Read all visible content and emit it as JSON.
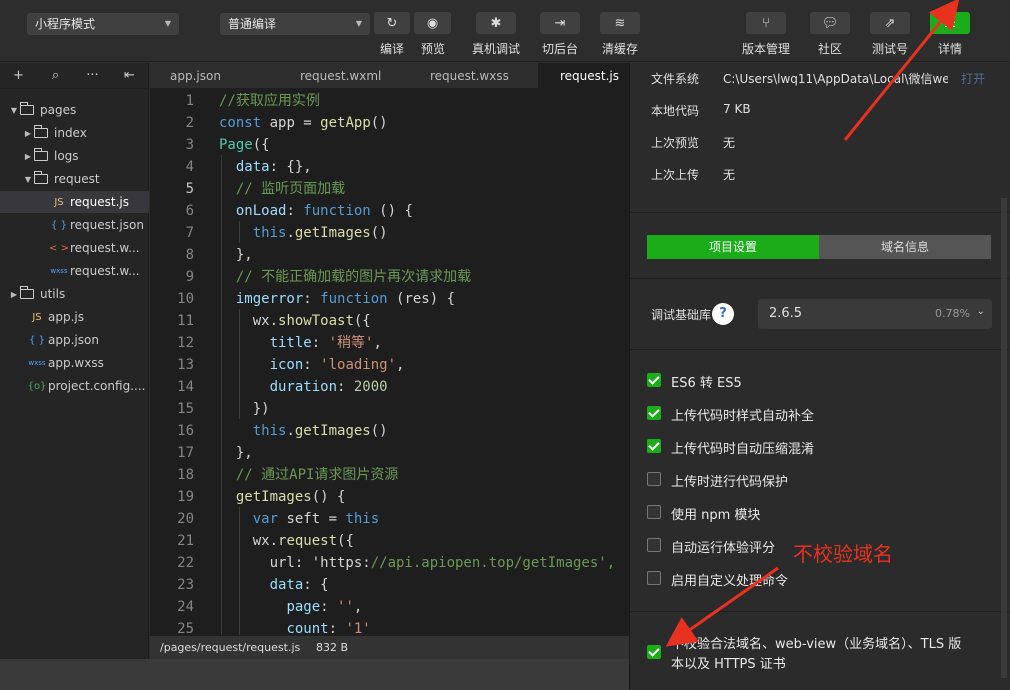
{
  "toolbar": {
    "mode_select": "小程序模式",
    "compile_select": "普通编译",
    "compile_label": "编译",
    "preview_label": "预览",
    "remote_debug_label": "真机调试",
    "background_label": "切后台",
    "clear_cache_label": "清缓存",
    "version_label": "版本管理",
    "community_label": "社区",
    "test_label": "测试号",
    "details_label": "详情"
  },
  "explorer": {
    "items": [
      {
        "label": "pages",
        "type": "folder-open"
      },
      {
        "label": "index",
        "type": "folder"
      },
      {
        "label": "logs",
        "type": "folder"
      },
      {
        "label": "request",
        "type": "folder-open"
      },
      {
        "label": "request.js",
        "type": "js"
      },
      {
        "label": "request.json",
        "type": "json"
      },
      {
        "label": "request.w...",
        "type": "wxml"
      },
      {
        "label": "request.w...",
        "type": "wxss"
      },
      {
        "label": "utils",
        "type": "folder"
      },
      {
        "label": "app.js",
        "type": "js"
      },
      {
        "label": "app.json",
        "type": "json"
      },
      {
        "label": "app.wxss",
        "type": "wxss"
      },
      {
        "label": "project.config....",
        "type": "config"
      }
    ],
    "icon_js": "JS",
    "icon_json": "{ }",
    "icon_wxml": "< >",
    "icon_wxss": "wxss",
    "icon_config": "{o}"
  },
  "tabs": [
    "app.json",
    "request.wxml",
    "request.wxss",
    "request.js"
  ],
  "code_lines": [
    {
      "n": "1",
      "t": "//获取应用实例"
    },
    {
      "n": "2",
      "t": "const app = getApp()"
    },
    {
      "n": "3",
      "t": "Page({"
    },
    {
      "n": "4",
      "t": "  data: {},"
    },
    {
      "n": "5",
      "t": "  // 监听页面加载"
    },
    {
      "n": "6",
      "t": "  onLoad: function () {"
    },
    {
      "n": "7",
      "t": "    this.getImages()"
    },
    {
      "n": "8",
      "t": "  },"
    },
    {
      "n": "9",
      "t": "  // 不能正确加载的图片再次请求加载"
    },
    {
      "n": "10",
      "t": "  imgerror: function (res) {"
    },
    {
      "n": "11",
      "t": "    wx.showToast({"
    },
    {
      "n": "12",
      "t": "      title: '稍等',"
    },
    {
      "n": "13",
      "t": "      icon: 'loading',"
    },
    {
      "n": "14",
      "t": "      duration: 2000"
    },
    {
      "n": "15",
      "t": "    })"
    },
    {
      "n": "16",
      "t": "    this.getImages()"
    },
    {
      "n": "17",
      "t": "  },"
    },
    {
      "n": "18",
      "t": "  // 通过API请求图片资源"
    },
    {
      "n": "19",
      "t": "  getImages() {"
    },
    {
      "n": "20",
      "t": "    var seft = this"
    },
    {
      "n": "21",
      "t": "    wx.request({"
    },
    {
      "n": "22",
      "t": "      url: 'https://api.apiopen.top/getImages',"
    },
    {
      "n": "23",
      "t": "      data: {"
    },
    {
      "n": "24",
      "t": "        page: '',"
    },
    {
      "n": "25",
      "t": "        count: '1'"
    }
  ],
  "status": {
    "path": "/pages/request/request.js",
    "size": "832 B"
  },
  "panel": {
    "fs_label": "文件系统",
    "fs_value": "C:\\Users\\lwq11\\AppData\\Local\\微信web...",
    "open_link": "打开",
    "local_code_label": "本地代码",
    "local_code_value": "7 KB",
    "last_preview_label": "上次预览",
    "last_preview_value": "无",
    "last_upload_label": "上次上传",
    "last_upload_value": "无",
    "tab_project": "项目设置",
    "tab_domain": "域名信息",
    "lib_label": "调试基础库",
    "lib_version": "2.6.5",
    "lib_percent": "0.78%",
    "options": [
      {
        "label": "ES6 转 ES5",
        "checked": true
      },
      {
        "label": "上传代码时样式自动补全",
        "checked": true
      },
      {
        "label": "上传代码时自动压缩混淆",
        "checked": true
      },
      {
        "label": "上传时进行代码保护",
        "checked": false
      },
      {
        "label": "使用 npm 模块",
        "checked": false
      },
      {
        "label": "自动运行体验评分",
        "checked": false
      },
      {
        "label": "启用自定义处理命令",
        "checked": false
      }
    ],
    "no_verify_line1": "不校验合法域名、web-view（业务域名）、TLS 版",
    "no_verify_line2": "本以及 HTTPS 证书",
    "no_verify_checked": true
  },
  "annotation": {
    "text": "不校验域名",
    "color": "#e8321f"
  }
}
